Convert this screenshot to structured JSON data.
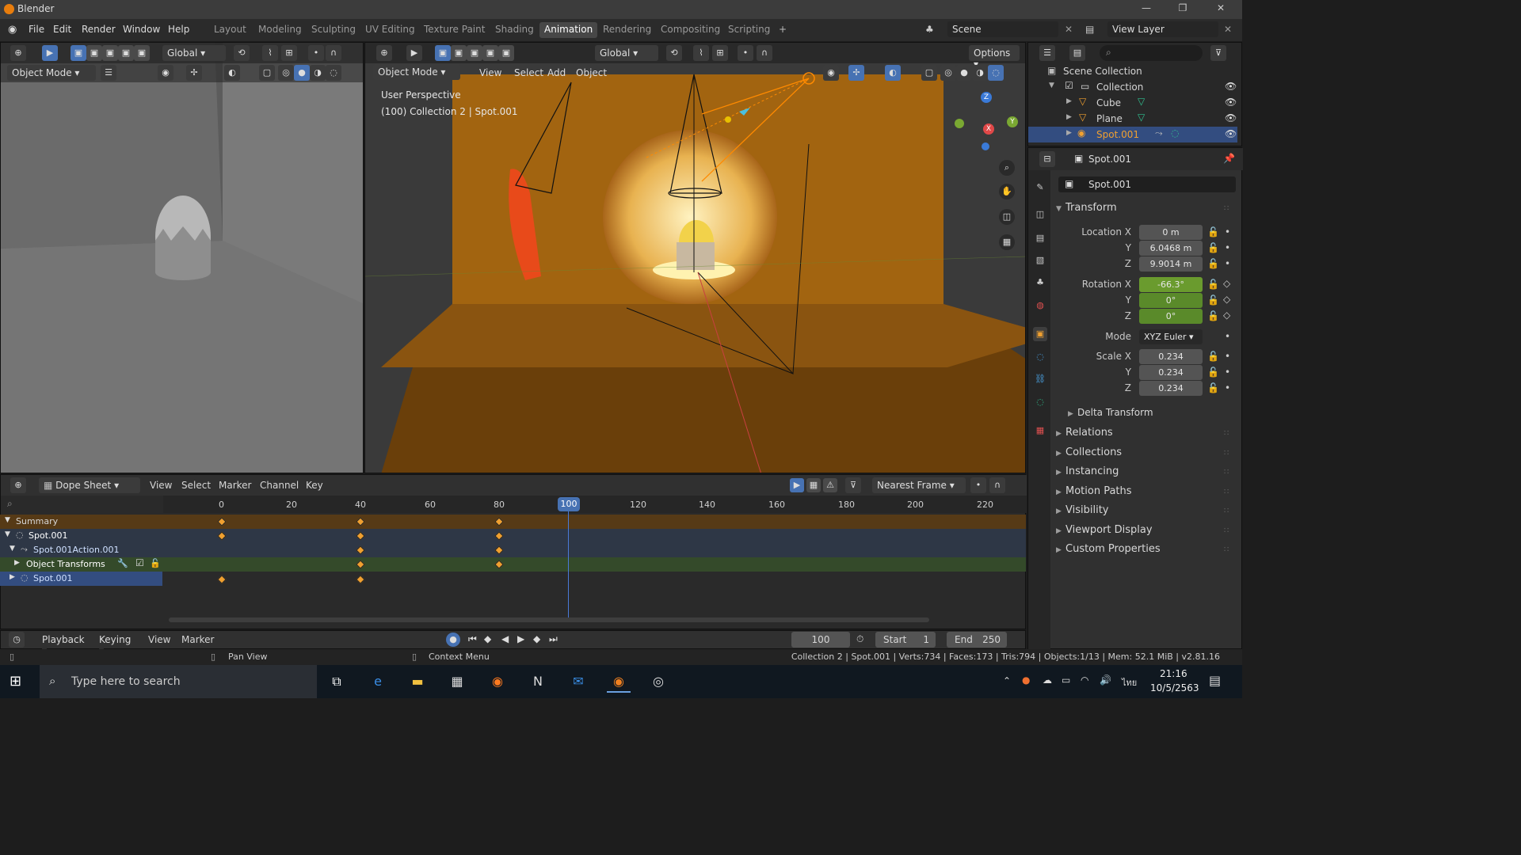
{
  "app": {
    "title": "Blender"
  },
  "menu": [
    "File",
    "Edit",
    "Render",
    "Window",
    "Help"
  ],
  "workspaces": [
    "Layout",
    "Modeling",
    "Sculpting",
    "UV Editing",
    "Texture Paint",
    "Shading",
    "Animation",
    "Rendering",
    "Compositing",
    "Scripting"
  ],
  "active_workspace": "Animation",
  "scene": {
    "name": "Scene",
    "view_layer": "View Layer"
  },
  "left_view": {
    "mode": "Object Mode",
    "orientation": "Global"
  },
  "main_view": {
    "mode": "Object Mode",
    "orientation": "Global",
    "menus": [
      "View",
      "Select",
      "Add",
      "Object"
    ],
    "options": "Options",
    "overlay_line1": "User Perspective",
    "overlay_line2": "(100) Collection 2 | Spot.001"
  },
  "outliner": {
    "root": "Scene Collection",
    "collection": "Collection",
    "items": [
      "Cube",
      "Plane",
      "Spot.001"
    ]
  },
  "properties": {
    "object_name": "Spot.001",
    "data_name": "Spot.001",
    "transform_title": "Transform",
    "location": {
      "label_x": "Location X",
      "label_y": "Y",
      "label_z": "Z",
      "x": "0 m",
      "y": "6.0468 m",
      "z": "9.9014 m"
    },
    "rotation": {
      "label_x": "Rotation X",
      "label_y": "Y",
      "label_z": "Z",
      "x": "-66.3°",
      "y": "0°",
      "z": "0°"
    },
    "mode_label": "Mode",
    "mode": "XYZ Euler",
    "scale": {
      "label_x": "Scale X",
      "label_y": "Y",
      "label_z": "Z",
      "x": "0.234",
      "y": "0.234",
      "z": "0.234"
    },
    "delta": "Delta Transform",
    "sections": [
      "Relations",
      "Collections",
      "Instancing",
      "Motion Paths",
      "Visibility",
      "Viewport Display",
      "Custom Properties"
    ]
  },
  "dopesheet": {
    "mode": "Dope Sheet",
    "menus": [
      "View",
      "Select",
      "Marker",
      "Channel",
      "Key"
    ],
    "snap": "Nearest Frame",
    "ruler": [
      "0",
      "20",
      "40",
      "60",
      "80",
      "100",
      "120",
      "140",
      "160",
      "180",
      "200",
      "220"
    ],
    "current_frame": "100",
    "channels": [
      "Summary",
      "Spot.001",
      "Spot.001Action.001",
      "Object Transforms",
      "Spot.001"
    ],
    "keyframes": [
      [
        0,
        40,
        80
      ],
      [
        0,
        40,
        80
      ],
      [
        40,
        80
      ],
      [
        40,
        80
      ],
      [
        0,
        40
      ]
    ]
  },
  "timeline": {
    "menus": [
      "Playback",
      "Keying",
      "View",
      "Marker"
    ],
    "frame": "100",
    "start_label": "Start",
    "start": "1",
    "end_label": "End",
    "end": "250"
  },
  "status": {
    "pan": "Pan View",
    "context": "Context Menu",
    "info": "Collection 2 | Spot.001 | Verts:734 | Faces:173 | Tris:794 | Objects:1/13 | Mem: 52.1 MiB | v2.81.16"
  },
  "taskbar": {
    "search_placeholder": "Type here to search",
    "time": "21:16",
    "date": "10/5/2563",
    "lang": "ไทย"
  },
  "colors": {
    "accent": "#4772b3",
    "anim_green": "#6a9b2e",
    "keyframe": "#f0a030",
    "orange_light": "#ff8a00"
  }
}
